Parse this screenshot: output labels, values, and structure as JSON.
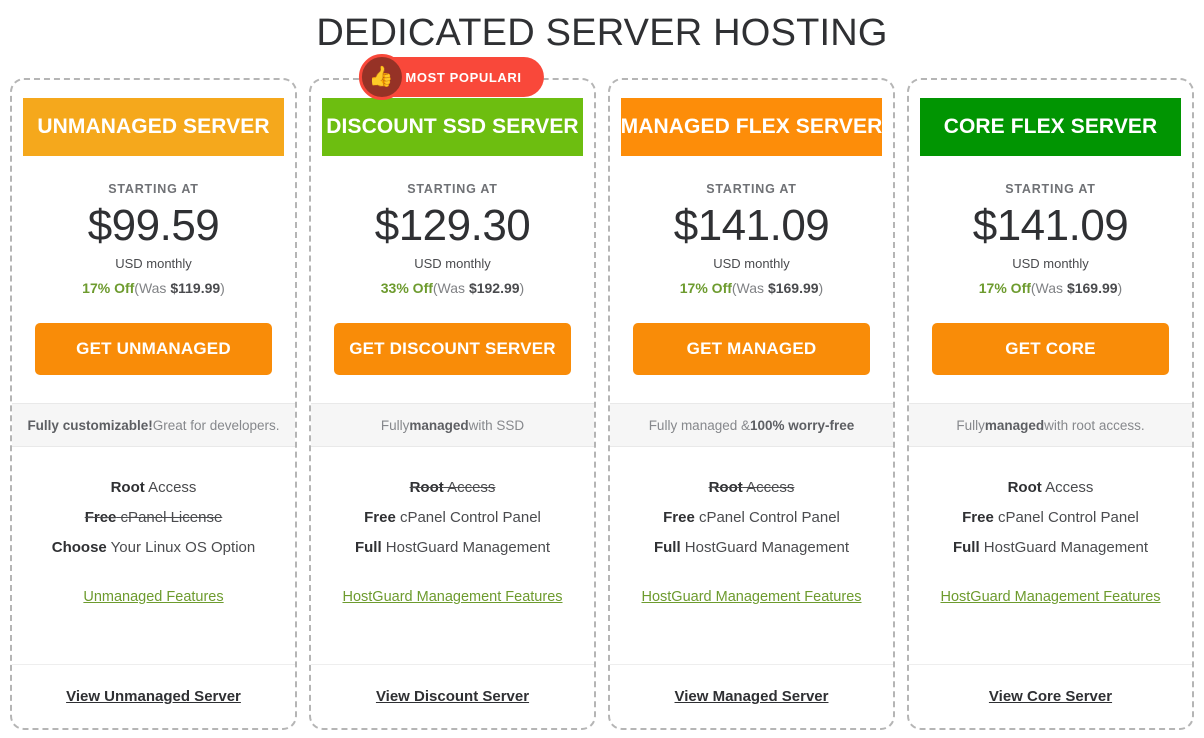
{
  "header": {
    "title": "DEDICATED SERVER HOSTING"
  },
  "badge": {
    "label": "MOST POPULARI",
    "icon": "thumbs-up-icon",
    "glyph": "👍",
    "pill_color": "#f9483a",
    "icon_circle_color": "#963226"
  },
  "labels": {
    "starting_at": "STARTING AT",
    "period": "USD monthly"
  },
  "cards": [
    {
      "name": "UNMANAGED SERVER",
      "header_color": "#f5a81c",
      "price": "$99.59",
      "discount_pct": "17% Off",
      "was_prefix": "(Was ",
      "was_amount": "$119.99",
      "was_suffix": ")",
      "cta_label": "GET UNMANAGED",
      "tagline_bold": "Fully customizable!",
      "tagline_rest": " Great for developers.",
      "features": [
        {
          "bold": "Root",
          "rest": " Access",
          "struck": false
        },
        {
          "bold": "Free",
          "rest": " cPanel License",
          "struck": true
        },
        {
          "bold": "Choose",
          "rest": " Your Linux OS Option",
          "struck": false
        }
      ],
      "features_link": "Unmanaged Features",
      "view_link": "View Unmanaged Server"
    },
    {
      "name": "DISCOUNT SSD SERVER",
      "header_color": "#6dbe10",
      "price": "$129.30",
      "discount_pct": "33% Off",
      "was_prefix": "(Was ",
      "was_amount": "$192.99",
      "was_suffix": ")",
      "cta_label": "GET DISCOUNT SERVER",
      "tagline_prefix": "Fully ",
      "tagline_bold": "managed",
      "tagline_rest": " with SSD",
      "features": [
        {
          "bold": "Root",
          "rest": " Access",
          "struck": true
        },
        {
          "bold": "Free",
          "rest": " cPanel Control Panel",
          "struck": false
        },
        {
          "bold": "Full",
          "rest": " HostGuard Management",
          "struck": false
        }
      ],
      "features_link": "HostGuard Management Features",
      "view_link": "View Discount Server"
    },
    {
      "name": "MANAGED FLEX SERVER",
      "header_color": "#fd8d09",
      "price": "$141.09",
      "discount_pct": "17% Off",
      "was_prefix": "(Was ",
      "was_amount": "$169.99",
      "was_suffix": ")",
      "cta_label": "GET MANAGED",
      "tagline_prefix": "Fully managed & ",
      "tagline_bold": "100% worry-free",
      "tagline_rest": "",
      "features": [
        {
          "bold": "Root",
          "rest": " Access",
          "struck": true
        },
        {
          "bold": "Free",
          "rest": " cPanel Control Panel",
          "struck": false
        },
        {
          "bold": "Full",
          "rest": " HostGuard Management",
          "struck": false
        }
      ],
      "features_link": "HostGuard Management Features",
      "view_link": "View Managed Server"
    },
    {
      "name": "CORE FLEX SERVER",
      "header_color": "#019502",
      "price": "$141.09",
      "discount_pct": "17% Off",
      "was_prefix": "(Was ",
      "was_amount": "$169.99",
      "was_suffix": ")",
      "cta_label": "GET CORE",
      "tagline_prefix": "Fully ",
      "tagline_bold": "managed",
      "tagline_rest": " with root access.",
      "features": [
        {
          "bold": "Root",
          "rest": " Access",
          "struck": false
        },
        {
          "bold": "Free",
          "rest": " cPanel Control Panel",
          "struck": false
        },
        {
          "bold": "Full",
          "rest": " HostGuard Management",
          "struck": false
        }
      ],
      "features_link": "HostGuard Management Features",
      "view_link": "View Core Server"
    }
  ]
}
